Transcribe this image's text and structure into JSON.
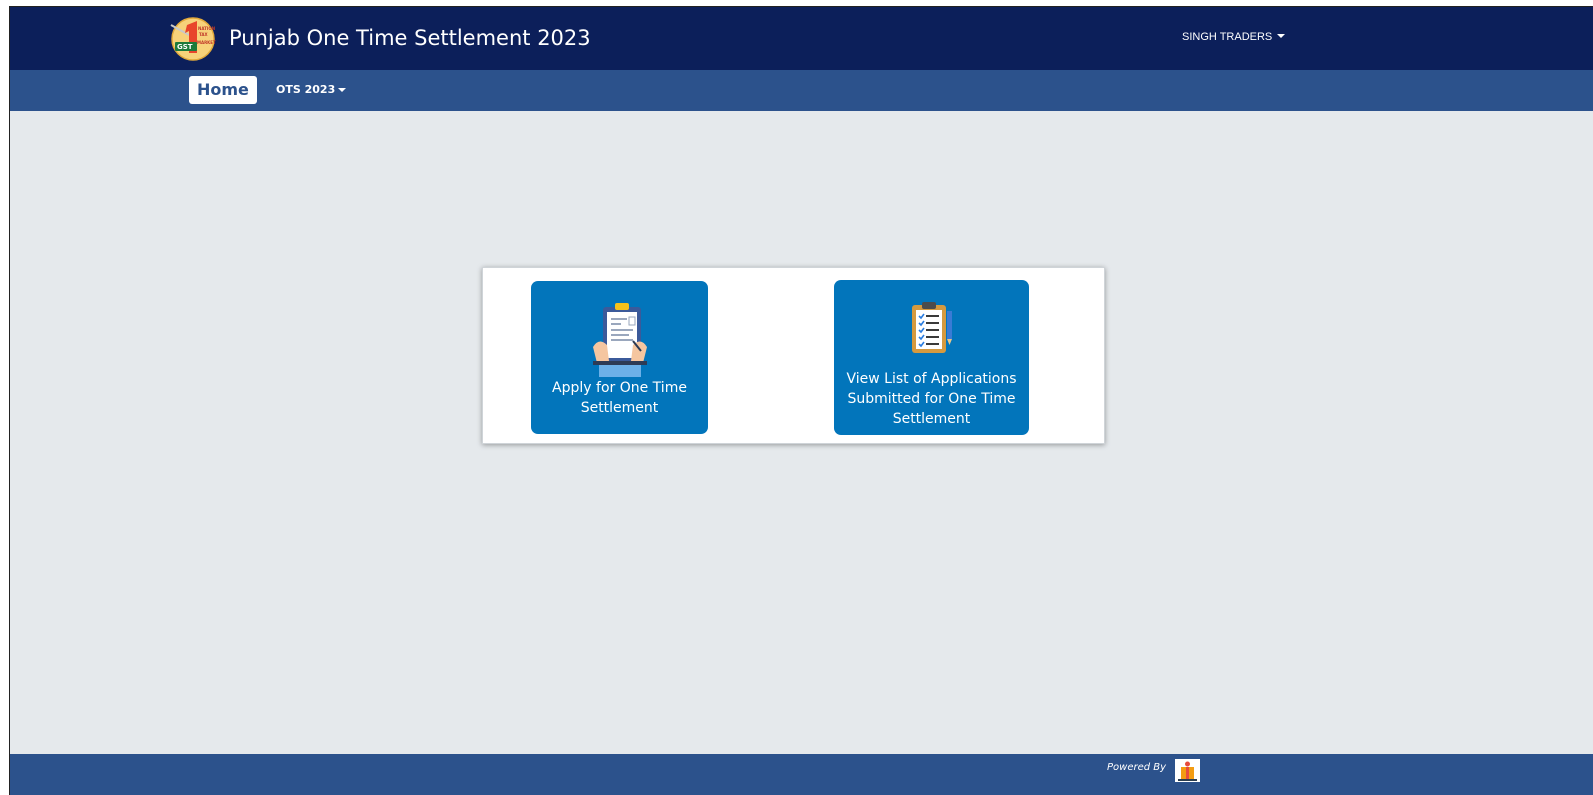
{
  "header": {
    "title": "Punjab One Time Settlement 2023",
    "user_name": "SINGH TRADERS",
    "logo_icon": "gst-one-nation-logo-icon"
  },
  "nav": {
    "home_label": "Home",
    "ots_label": "OTS 2023"
  },
  "tiles": [
    {
      "label": "Apply for One Time Settlement",
      "icon": "clipboard-hands-icon"
    },
    {
      "label": "View List of Applications Submitted for One Time Settlement",
      "icon": "checklist-clipboard-icon"
    }
  ],
  "footer": {
    "powered_by": "Powered By",
    "logo_icon": "nic-logo-icon"
  },
  "colors": {
    "header_bg": "#0c1f5a",
    "nav_bg": "#2c528c",
    "tile_bg": "#0275bb",
    "page_bg": "#e5e9ec"
  }
}
